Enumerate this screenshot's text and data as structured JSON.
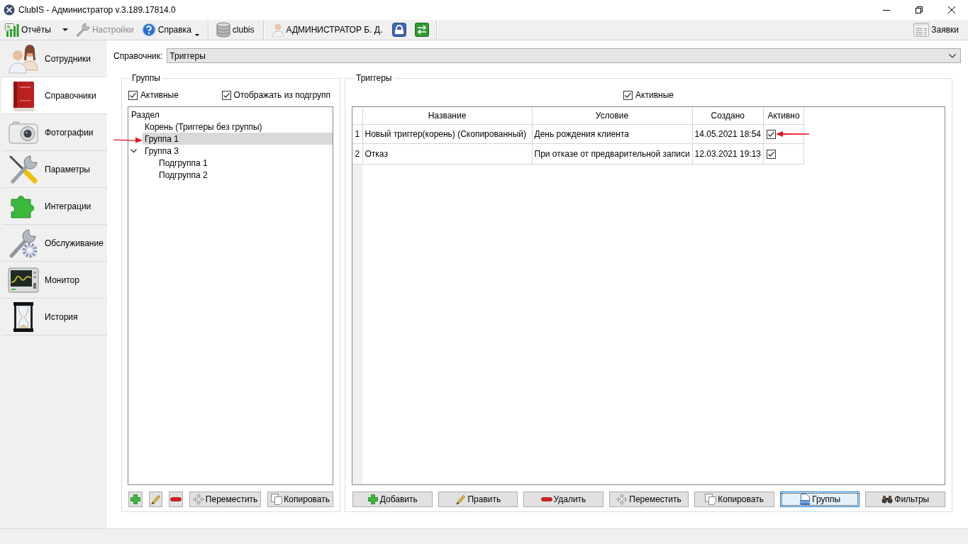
{
  "window": {
    "title": "ClubIS - Администратор v.3.189.17814.0"
  },
  "toolbar": {
    "items": [
      {
        "kind": "split",
        "label": "Отчёты",
        "disabled": false
      },
      {
        "kind": "button",
        "label": "Настройки",
        "disabled": true
      },
      {
        "kind": "menu",
        "label": "Справка",
        "disabled": false
      },
      {
        "kind": "separator"
      },
      {
        "kind": "button",
        "label": "clubis",
        "disabled": false
      },
      {
        "kind": "separator"
      },
      {
        "kind": "button",
        "label": "АДМИНИСТРАТОР Б. Д.",
        "disabled": false
      },
      {
        "kind": "icon",
        "disabled": false
      },
      {
        "kind": "icon",
        "disabled": false
      },
      {
        "kind": "separator"
      }
    ],
    "right": [
      {
        "label": "Заявки"
      }
    ]
  },
  "sidebar": {
    "items": [
      {
        "label": "Сотрудники",
        "selected": false
      },
      {
        "label": "Справочники",
        "selected": true
      },
      {
        "label": "Фотографии",
        "selected": false
      },
      {
        "label": "Параметры",
        "selected": false
      },
      {
        "label": "Интеграции",
        "selected": false
      },
      {
        "label": "Обслуживание",
        "selected": false
      },
      {
        "label": "Монитор",
        "selected": false
      },
      {
        "label": "История",
        "selected": false
      }
    ]
  },
  "reference": {
    "label": "Справочник:",
    "value": "Триггеры"
  },
  "groups": {
    "title": "Группы",
    "checkboxes": [
      {
        "label": "Активные",
        "checked": true
      },
      {
        "label": "Отображать из подгрупп",
        "checked": true
      }
    ],
    "tree": {
      "header": "Раздел",
      "items": [
        {
          "label": "Корень (Триггеры без группы)",
          "selected": false
        },
        {
          "label": "Группа 1",
          "selected": true
        },
        {
          "label": "Группа 3",
          "selected": false,
          "expanded": true,
          "children": [
            {
              "label": "Подгруппа 1",
              "selected": false
            },
            {
              "label": "Подгруппа 2",
              "selected": false
            }
          ]
        }
      ]
    },
    "buttons": [
      {
        "kind": "add"
      },
      {
        "kind": "edit"
      },
      {
        "kind": "delete"
      },
      {
        "kind": "move",
        "label": "Переместить"
      },
      {
        "kind": "copy",
        "label": "Копировать"
      }
    ]
  },
  "triggers": {
    "title": "Триггеры",
    "checkbox": {
      "label": "Активные",
      "checked": true
    },
    "table": {
      "columns": [
        "Название",
        "Условие",
        "Создано",
        "Активно"
      ],
      "rows": [
        {
          "number": "1",
          "name": "Новый триггер(корень) (Скопированный)",
          "condition": "День рождения клиента",
          "created": "14.05.2021 18:54",
          "active": true
        },
        {
          "number": "2",
          "name": "Отказ",
          "condition": "При отказе от предварительной записи",
          "created": "12.03.2021 19:13",
          "active": true
        }
      ]
    },
    "buttons": [
      {
        "kind": "add",
        "label": "Добавить",
        "pressed": false
      },
      {
        "kind": "edit",
        "label": "Править",
        "pressed": false
      },
      {
        "kind": "delete",
        "label": "Удалить",
        "pressed": false
      },
      {
        "kind": "move",
        "label": "Переместить",
        "pressed": false
      },
      {
        "kind": "copy",
        "label": "Копировать",
        "pressed": false
      },
      {
        "kind": "groups",
        "label": "Группы",
        "pressed": true
      },
      {
        "kind": "filters",
        "label": "Фильтры",
        "pressed": false
      }
    ]
  }
}
